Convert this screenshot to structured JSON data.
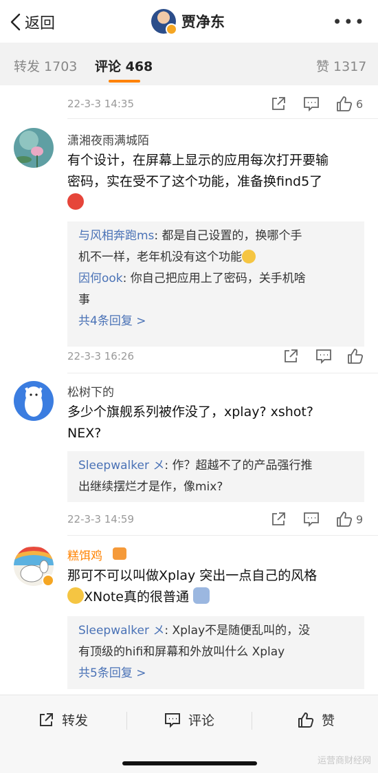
{
  "header": {
    "back_label": "返回",
    "title": "贾净东",
    "more": "•••"
  },
  "tabs": [
    {
      "label": "转发 1703"
    },
    {
      "label": "评论 468"
    },
    {
      "label": "赞 1317"
    }
  ],
  "accent_color": "#ff8200",
  "link_color": "#4a72b6",
  "top_meta": {
    "time": "22-3-3 14:35",
    "likes": "6"
  },
  "comments": [
    {
      "author": "潇湘夜雨满城陌",
      "body_line1": "有个设计，在屏幕上显示的应用每次打开要输",
      "body_line2": "密码，实在受不了这个功能，准备换find5了",
      "body_emoji": "angry-face-emoji",
      "replies": [
        {
          "who": "与风相奔跑ms",
          "text": ": 都是自己设置的，换哪个手",
          "text2": "机不一样，老年机没有这个功能"
        },
        {
          "who": "因何ook",
          "text": ": 你自己把应用上了密码，关手机啥",
          "text2": "事"
        }
      ],
      "more_replies": "共4条回复 >",
      "time": "22-3-3 16:26",
      "likes": ""
    },
    {
      "author": "松树下的",
      "body_line1": "多少个旗舰系列被作没了，xplay? xshot?",
      "body_line2": "NEX?",
      "replies": [
        {
          "who": "Sleepwalker メ",
          "text": ": 作？超越不了的产品强行推",
          "text2": "出继续摆烂才是作，像mix?"
        }
      ],
      "time": "22-3-3 14:59",
      "likes": "9"
    },
    {
      "author": "糕饵鸡",
      "body_line1": "那可不可以叫做Xplay 突出一点自己的风格",
      "body_line2": "XNote真的很普通",
      "replies": [
        {
          "who": "Sleepwalker メ",
          "text": ": Xplay不是随便乱叫的，没",
          "text2": "有顶级的hifi和屏幕和外放叫什么 Xplay"
        }
      ],
      "more_replies": "共5条回复 >"
    }
  ],
  "bottom_bar": {
    "repost": "转发",
    "comment": "评论",
    "like": "赞"
  },
  "watermark": "运营商财经网"
}
